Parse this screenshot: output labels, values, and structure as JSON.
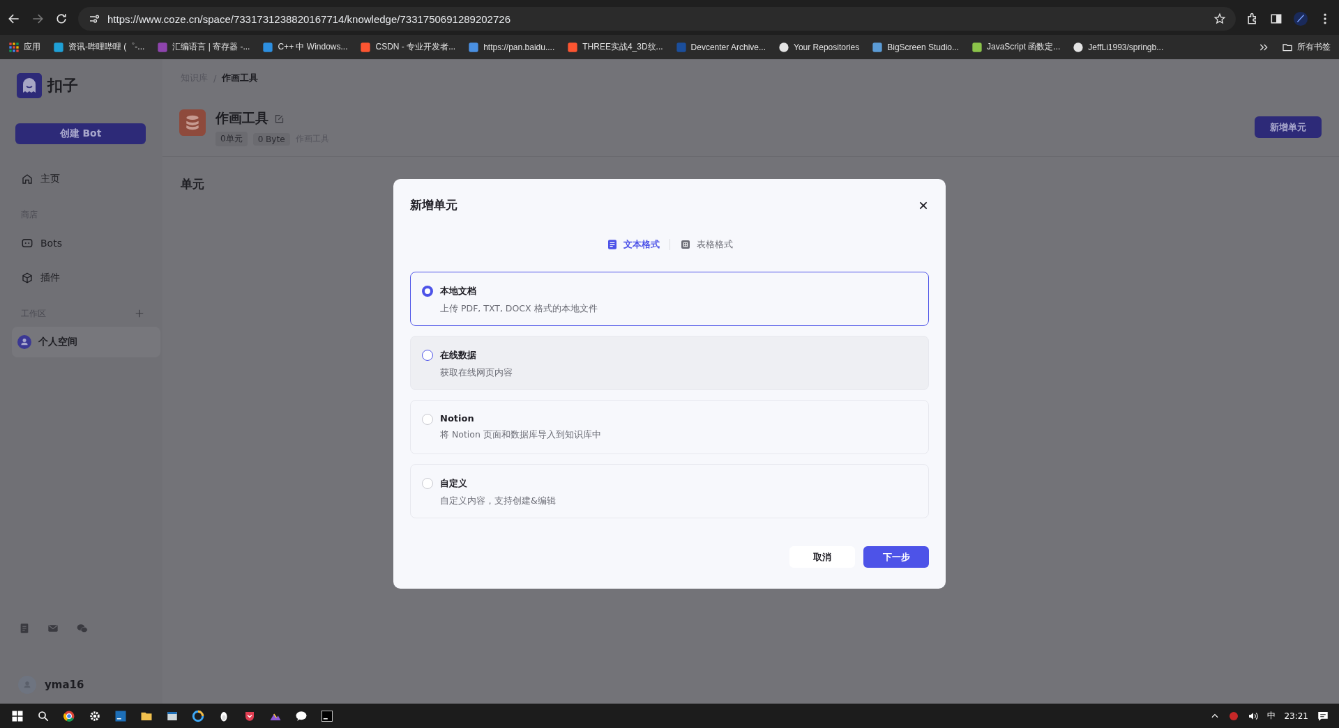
{
  "browser": {
    "address": "https://www.coze.cn/space/7331731238820167714/knowledge/7331750691289202726",
    "bookmarks": [
      "应用",
      "资讯-哔哩哔哩 (゜-...",
      "汇编语言 | 寄存器 -...",
      "C++ 中 Windows...",
      "CSDN - 专业开发者...",
      "https://pan.baidu....",
      "THREE实战4_3D纹...",
      "Devcenter Archive...",
      "Your Repositories",
      "BigScreen Studio...",
      "JavaScript 函数定...",
      "JeffLi1993/springb..."
    ],
    "all_bookmarks": "所有书签"
  },
  "sidebar": {
    "logo": "扣子",
    "create_button": "创建 Bot",
    "items": [
      {
        "kind": "home",
        "label": "主页",
        "selected": false
      },
      {
        "kind": "heading",
        "label": "商店",
        "add": false
      },
      {
        "kind": "bot",
        "label": "Bots",
        "selected": false
      },
      {
        "kind": "plugin",
        "label": "插件",
        "selected": false
      },
      {
        "kind": "heading",
        "label": "工作区",
        "add": true
      },
      {
        "kind": "space",
        "label": "个人空间",
        "selected": true
      }
    ],
    "user": "yma16"
  },
  "main": {
    "breadcrumb": [
      "知识库",
      "作画工具"
    ],
    "breadcrumb_separator": "/",
    "title": "作画工具",
    "tags": [
      "0单元",
      "0 Byte"
    ],
    "description": "作画工具",
    "new_button": "新增单元",
    "section": "单元"
  },
  "dialog": {
    "title": "新增单元",
    "tabs": [
      {
        "label": "文本格式",
        "selected": true
      },
      {
        "label": "表格格式",
        "selected": false
      }
    ],
    "options": [
      {
        "title": "本地文档",
        "description": "上传 PDF, TXT, DOCX 格式的本地文件",
        "selected": true,
        "hovered": false
      },
      {
        "title": "在线数据",
        "description": "获取在线网页内容",
        "selected": false,
        "hovered": true
      },
      {
        "title": "Notion",
        "description": "将 Notion 页面和数据库导入到知识库中",
        "selected": false,
        "hovered": false
      },
      {
        "title": "自定义",
        "description": "自定义内容，支持创建&编辑",
        "selected": false,
        "hovered": false
      }
    ],
    "cancel": "取消",
    "next": "下一步"
  },
  "taskbar": {
    "ime": "中",
    "clock": "23:21"
  }
}
